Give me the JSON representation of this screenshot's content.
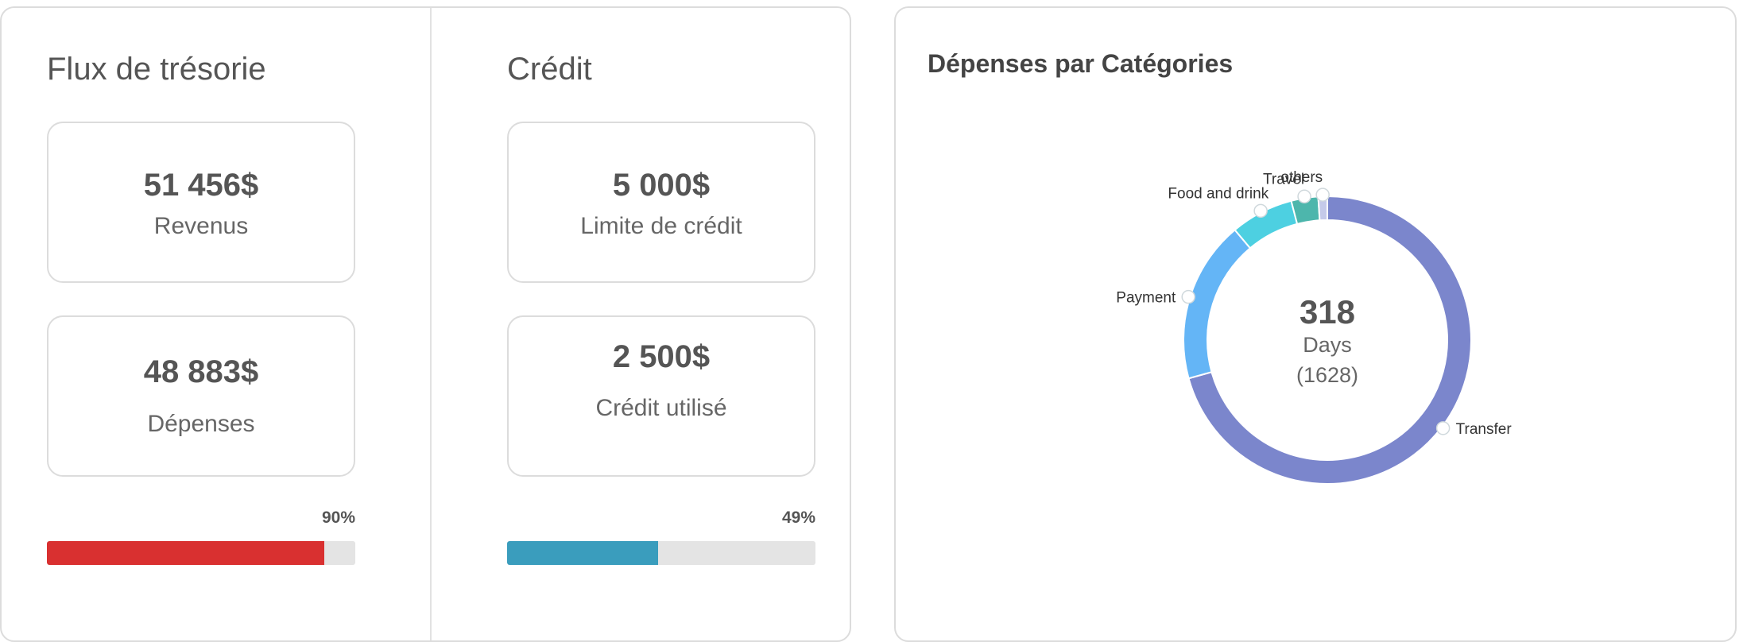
{
  "cash_flow": {
    "title": "Flux de trésorie",
    "income": {
      "value": "51 456$",
      "label": "Revenus"
    },
    "expenses": {
      "value": "48 883$",
      "label": "Dépenses"
    },
    "progress": {
      "percent_text": "90%",
      "fraction": 0.9,
      "color": "#d93030"
    }
  },
  "credit": {
    "title": "Crédit",
    "limit": {
      "value": "5 000$",
      "label": "Limite de crédit"
    },
    "used": {
      "value": "2 500$",
      "label": "Crédit utilisé"
    },
    "progress": {
      "percent_text": "49%",
      "fraction": 0.49,
      "color": "#3a9dbd"
    }
  },
  "expenses_by_category": {
    "title": "Dépenses par Catégories",
    "center": {
      "value": "318",
      "unit": "Days",
      "count": "(1628)"
    }
  },
  "chart_data": {
    "type": "pie",
    "style": "donut",
    "title": "Dépenses par Catégories",
    "categories": [
      "Transfer",
      "Payment",
      "Food and drink",
      "Travel",
      "others"
    ],
    "values": [
      70,
      18,
      7,
      3,
      1
    ],
    "colors": [
      "#7b86cc",
      "#64b5f6",
      "#4dd0e1",
      "#4db6ac",
      "#c5cae9"
    ],
    "legend": "labels-on-slices"
  }
}
